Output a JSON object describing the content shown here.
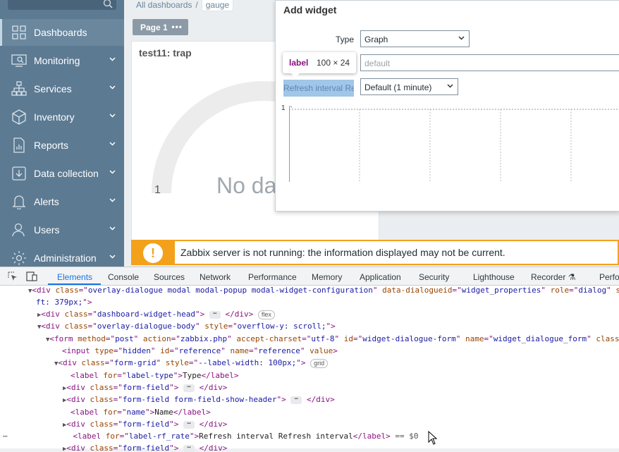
{
  "sidebar": {
    "search_placeholder": "",
    "items": [
      {
        "label": "Dashboards",
        "icon": "dashboards-icon",
        "active": true
      },
      {
        "label": "Monitoring",
        "icon": "monitoring-icon"
      },
      {
        "label": "Services",
        "icon": "services-icon"
      },
      {
        "label": "Inventory",
        "icon": "inventory-icon"
      },
      {
        "label": "Reports",
        "icon": "reports-icon"
      },
      {
        "label": "Data collection",
        "icon": "data-collection-icon"
      },
      {
        "label": "Alerts",
        "icon": "alerts-icon"
      },
      {
        "label": "Users",
        "icon": "users-icon"
      },
      {
        "label": "Administration",
        "icon": "administration-icon"
      }
    ]
  },
  "breadcrumb": {
    "root": "All dashboards",
    "sep": "/",
    "current": "gauge"
  },
  "page_tab": {
    "label": "Page 1"
  },
  "widget": {
    "title": "test11: trap",
    "gauge_min": "1",
    "no_data": "No data"
  },
  "warning": {
    "text": "Zabbix server is not running: the information displayed may not be current."
  },
  "modal": {
    "title": "Add widget",
    "type_label": "Type",
    "type_value": "Graph",
    "name_placeholder": "default",
    "refresh_label": "Refresh interval Refresh interval",
    "refresh_value": "Default (1 minute)",
    "graph_y": "1"
  },
  "tooltip": {
    "tag": "label",
    "dims": "100 × 24"
  },
  "devtools": {
    "tabs": [
      "Elements",
      "Console",
      "Sources",
      "Network",
      "Performance",
      "Memory",
      "Application",
      "Security",
      "Lighthouse",
      "Recorder",
      "Perfo"
    ],
    "active_tab": "Elements"
  },
  "colors": {
    "sidebar": "#5c7a92",
    "warning": "#f3a11b",
    "accent": "#1a73e8"
  }
}
